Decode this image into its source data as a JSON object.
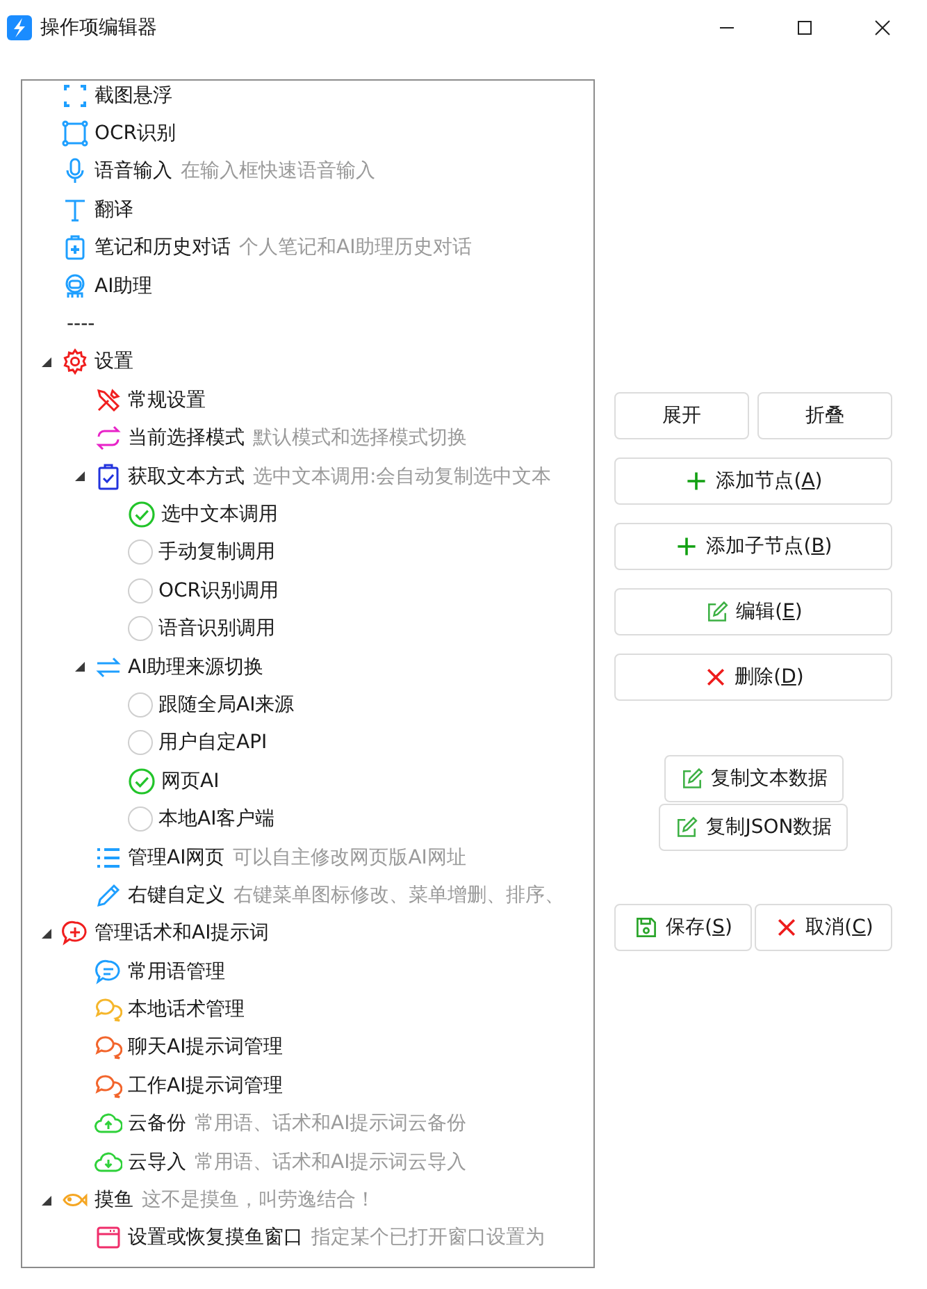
{
  "window": {
    "title": "操作项编辑器"
  },
  "tree": {
    "items": [
      {
        "kind": "node",
        "label": "截图悬浮"
      },
      {
        "kind": "node",
        "label": "OCR识别"
      },
      {
        "kind": "node",
        "label": "语音输入",
        "note": "在输入框快速语音输入"
      },
      {
        "kind": "node",
        "label": "翻译"
      },
      {
        "kind": "node",
        "label": "笔记和历史对话",
        "note": "个人笔记和AI助理历史对话"
      },
      {
        "kind": "node",
        "label": "AI助理"
      },
      {
        "kind": "separator",
        "label": "----"
      },
      {
        "kind": "node",
        "label": "设置",
        "expanded": true,
        "children": [
          {
            "kind": "node",
            "label": "常规设置"
          },
          {
            "kind": "node",
            "label": "当前选择模式",
            "note": "默认模式和选择模式切换"
          },
          {
            "kind": "node",
            "label": "获取文本方式",
            "note": "选中文本调用:会自动复制选中文本",
            "expanded": true,
            "children": [
              {
                "kind": "option",
                "label": "选中文本调用",
                "selected": true
              },
              {
                "kind": "option",
                "label": "手动复制调用",
                "selected": false
              },
              {
                "kind": "option",
                "label": "OCR识别调用",
                "selected": false
              },
              {
                "kind": "option",
                "label": "语音识别调用",
                "selected": false
              }
            ]
          },
          {
            "kind": "node",
            "label": "AI助理来源切换",
            "expanded": true,
            "children": [
              {
                "kind": "option",
                "label": "跟随全局AI来源",
                "selected": false
              },
              {
                "kind": "option",
                "label": "用户自定API",
                "selected": false
              },
              {
                "kind": "option",
                "label": "网页AI",
                "selected": true
              },
              {
                "kind": "option",
                "label": "本地AI客户端",
                "selected": false
              }
            ]
          },
          {
            "kind": "node",
            "label": "管理AI网页",
            "note": "可以自主修改网页版AI网址"
          },
          {
            "kind": "node",
            "label": "右键自定义",
            "note": "右键菜单图标修改、菜单增删、排序、"
          }
        ]
      },
      {
        "kind": "node",
        "label": "管理话术和AI提示词",
        "expanded": true,
        "children": [
          {
            "kind": "node",
            "label": "常用语管理"
          },
          {
            "kind": "node",
            "label": "本地话术管理"
          },
          {
            "kind": "node",
            "label": "聊天AI提示词管理"
          },
          {
            "kind": "node",
            "label": "工作AI提示词管理"
          },
          {
            "kind": "node",
            "label": "云备份",
            "note": "常用语、话术和AI提示词云备份"
          },
          {
            "kind": "node",
            "label": "云导入",
            "note": "常用语、话术和AI提示词云导入"
          }
        ]
      },
      {
        "kind": "node",
        "label": "摸鱼",
        "note": "这不是摸鱼，叫劳逸结合！",
        "expanded": true,
        "children": [
          {
            "kind": "node",
            "label": "设置或恢复摸鱼窗口",
            "note": "指定某个已打开窗口设置为"
          }
        ]
      }
    ]
  },
  "view_buttons": [
    {
      "label": "展开"
    },
    {
      "label": "折叠"
    }
  ],
  "edit_buttons": [
    {
      "label": "添加节点(",
      "access_key": "A",
      "label_end": ")"
    },
    {
      "label": "添加子节点(",
      "access_key": "B",
      "label_end": ")"
    },
    {
      "label": "编辑(",
      "access_key": "E",
      "label_end": ")"
    },
    {
      "label": "删除(",
      "access_key": "D",
      "label_end": ")"
    }
  ],
  "copy_buttons": [
    {
      "label": "复制文本数据"
    },
    {
      "label": "复制JSON数据"
    }
  ],
  "dialog_buttons": [
    {
      "label": "保存(",
      "access_key": "S",
      "label_end": ")"
    },
    {
      "label": "取消(",
      "access_key": "C",
      "label_end": ")"
    }
  ]
}
